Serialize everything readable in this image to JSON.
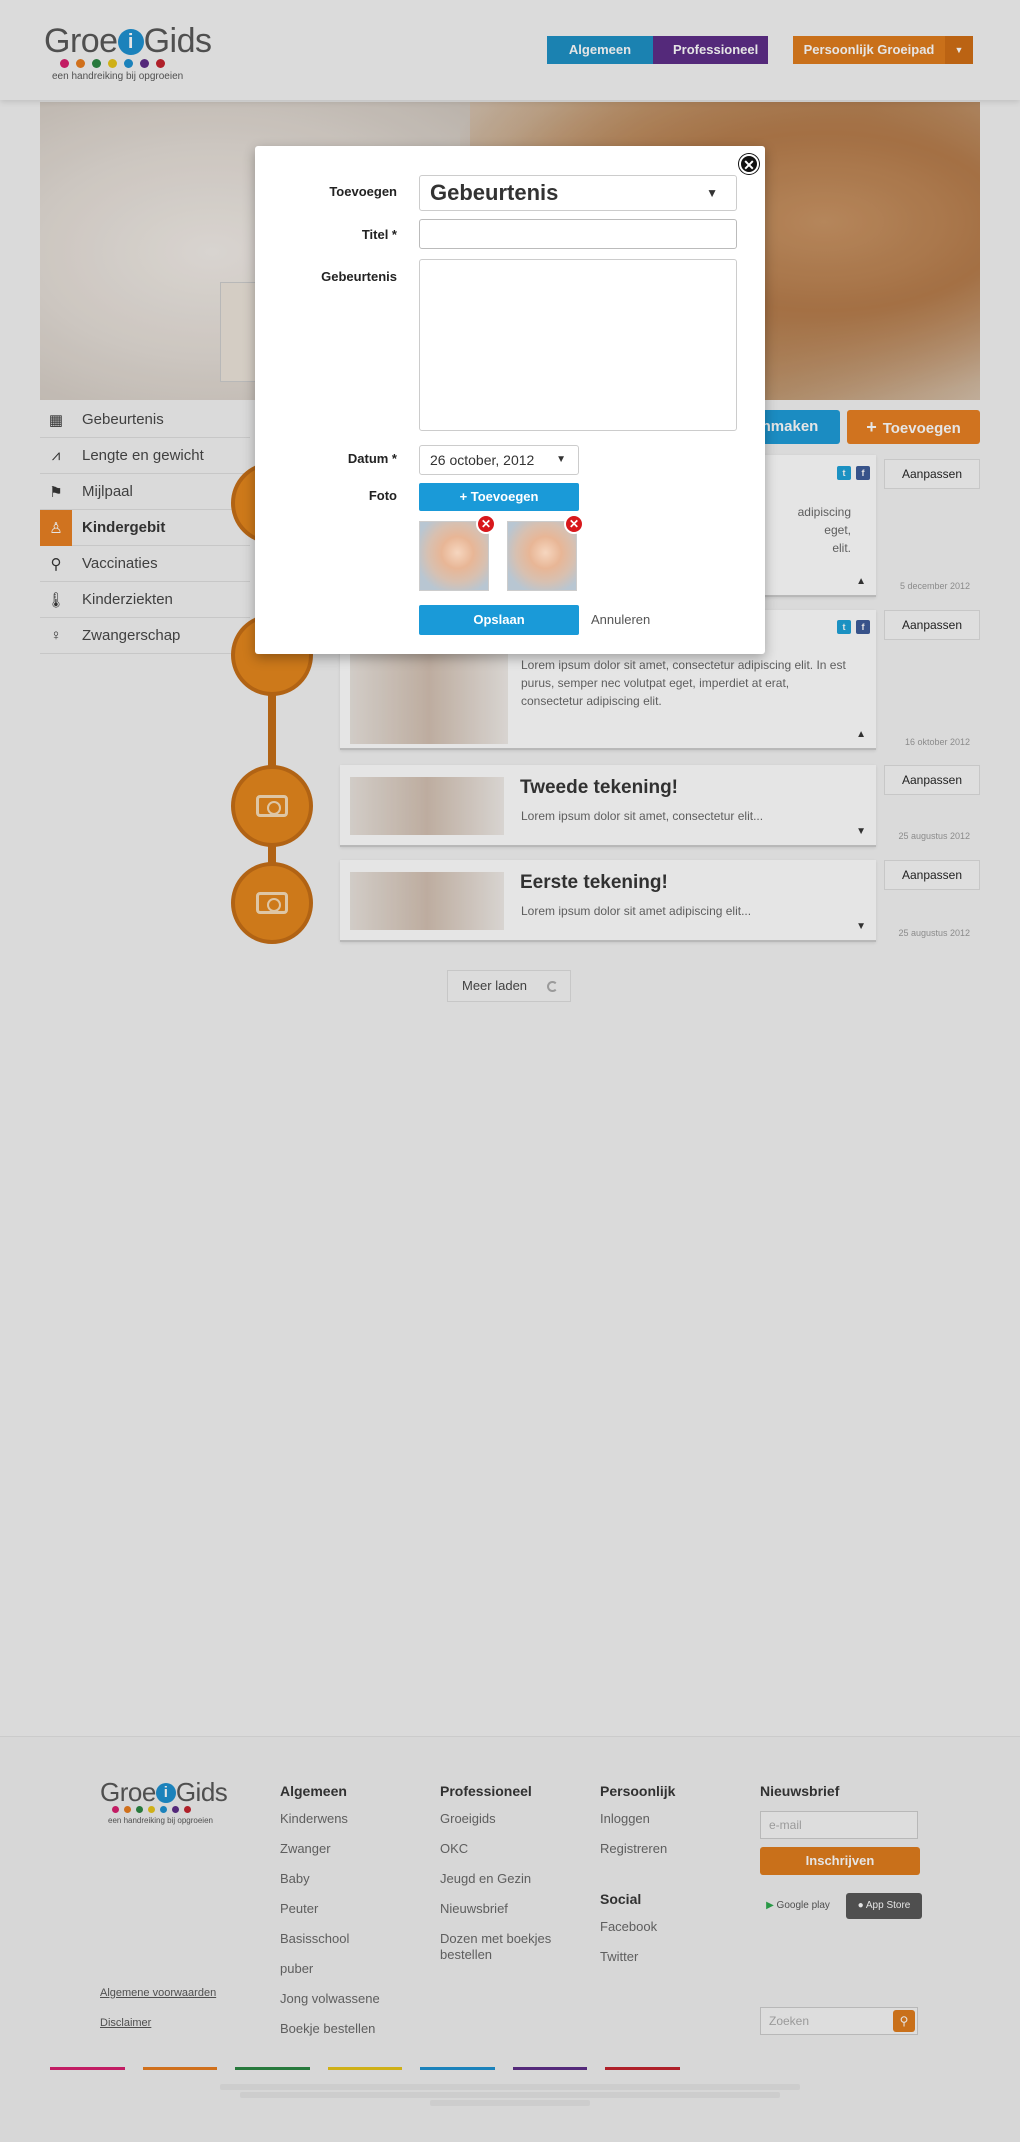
{
  "header": {
    "logo_part1": "Groe",
    "logo_i": "i",
    "logo_part2": "Gids",
    "tagline": "een handreiking bij opgroeien",
    "dot_colors": [
      "#d81b6c",
      "#e87a1b",
      "#27853f",
      "#e6c315",
      "#1a8fd0",
      "#5b2a86",
      "#c21f2a"
    ],
    "nav_general": "Algemeen",
    "nav_professional": "Professioneel",
    "nav_personal": "Persoonlijk Groeipad",
    "nav_personal_caret": "▼"
  },
  "colors": {
    "blue": "#1a9ad8",
    "purple": "#5b2a86",
    "orange": "#e77e1e"
  },
  "sidebar": {
    "items": [
      {
        "label": "Gebeurtenis",
        "icon": "calendar-icon"
      },
      {
        "label": "Lengte en gewicht",
        "icon": "chart-icon"
      },
      {
        "label": "Mijlpaal",
        "icon": "flag-icon"
      },
      {
        "label": "Kindergebit",
        "icon": "tooth-icon",
        "active": true
      },
      {
        "label": "Vaccinaties",
        "icon": "syringe-icon"
      },
      {
        "label": "Kinderziekten",
        "icon": "thermometer-icon"
      },
      {
        "label": "Zwangerschap",
        "icon": "pregnancy-icon"
      }
    ]
  },
  "actions": {
    "create_label": "nmaken",
    "add_label": "Toevoegen",
    "add_icon": "+"
  },
  "timeline": {
    "edit_label": "Aanpassen",
    "items": [
      {
        "title": "",
        "body": "adipiscing\neget,\nelit.",
        "date": "5 december 2012"
      },
      {
        "title": "",
        "body": "Lorem ipsum dolor sit amet, consectetur adipiscing elit. In est purus, semper nec volutpat eget, imperdiet at erat, consectetur adipiscing elit.",
        "date": "16 oktober 2012"
      },
      {
        "title": "Tweede tekening!",
        "body": "Lorem ipsum dolor sit amet, consectetur elit...",
        "date": "25 augustus 2012"
      },
      {
        "title": "Eerste tekening!",
        "body": "Lorem ipsum dolor sit amet adipiscing elit...",
        "date": "25 augustus 2012"
      }
    ],
    "more_label": "Meer laden"
  },
  "modal": {
    "close_symbol": "✕",
    "type_label": "Toevoegen",
    "type_value": "Gebeurtenis",
    "title_label": "Titel *",
    "title_value": "",
    "body_label": "Gebeurtenis",
    "date_label": "Datum *",
    "date_value": "26 october, 2012",
    "photo_label": "Foto",
    "photo_add": "+ Toevoegen",
    "remove_symbol": "✕",
    "save_label": "Opslaan",
    "cancel_label": "Annuleren"
  },
  "footer": {
    "logo_part1": "Groe",
    "logo_i": "i",
    "logo_part2": "Gids",
    "tagline": "een handreiking bij opgroeien",
    "col_general": {
      "title": "Algemeen",
      "links": [
        "Kinderwens",
        "Zwanger",
        "Baby",
        "Peuter",
        "Basisschool",
        "puber",
        "Jong volwassene",
        "Boekje bestellen"
      ]
    },
    "col_professional": {
      "title": "Professioneel",
      "links": [
        "Groeigids",
        "OKC",
        "Jeugd en Gezin",
        "Nieuwsbrief",
        "Dozen met boekjes bestellen"
      ]
    },
    "col_personal": {
      "title": "Persoonlijk",
      "links": [
        "Inloggen",
        "Registreren"
      ]
    },
    "col_social": {
      "title": "Social",
      "links": [
        "Facebook",
        "Twitter"
      ]
    },
    "newsletter": {
      "title": "Nieuwsbrief",
      "email_placeholder": "e-mail",
      "subscribe": "Inschrijven",
      "google_play": "Google play",
      "app_store": "App Store"
    },
    "search_placeholder": "Zoeken",
    "legal_terms": "Algemene voorwaarden",
    "legal_disclaimer": "Disclaimer"
  }
}
